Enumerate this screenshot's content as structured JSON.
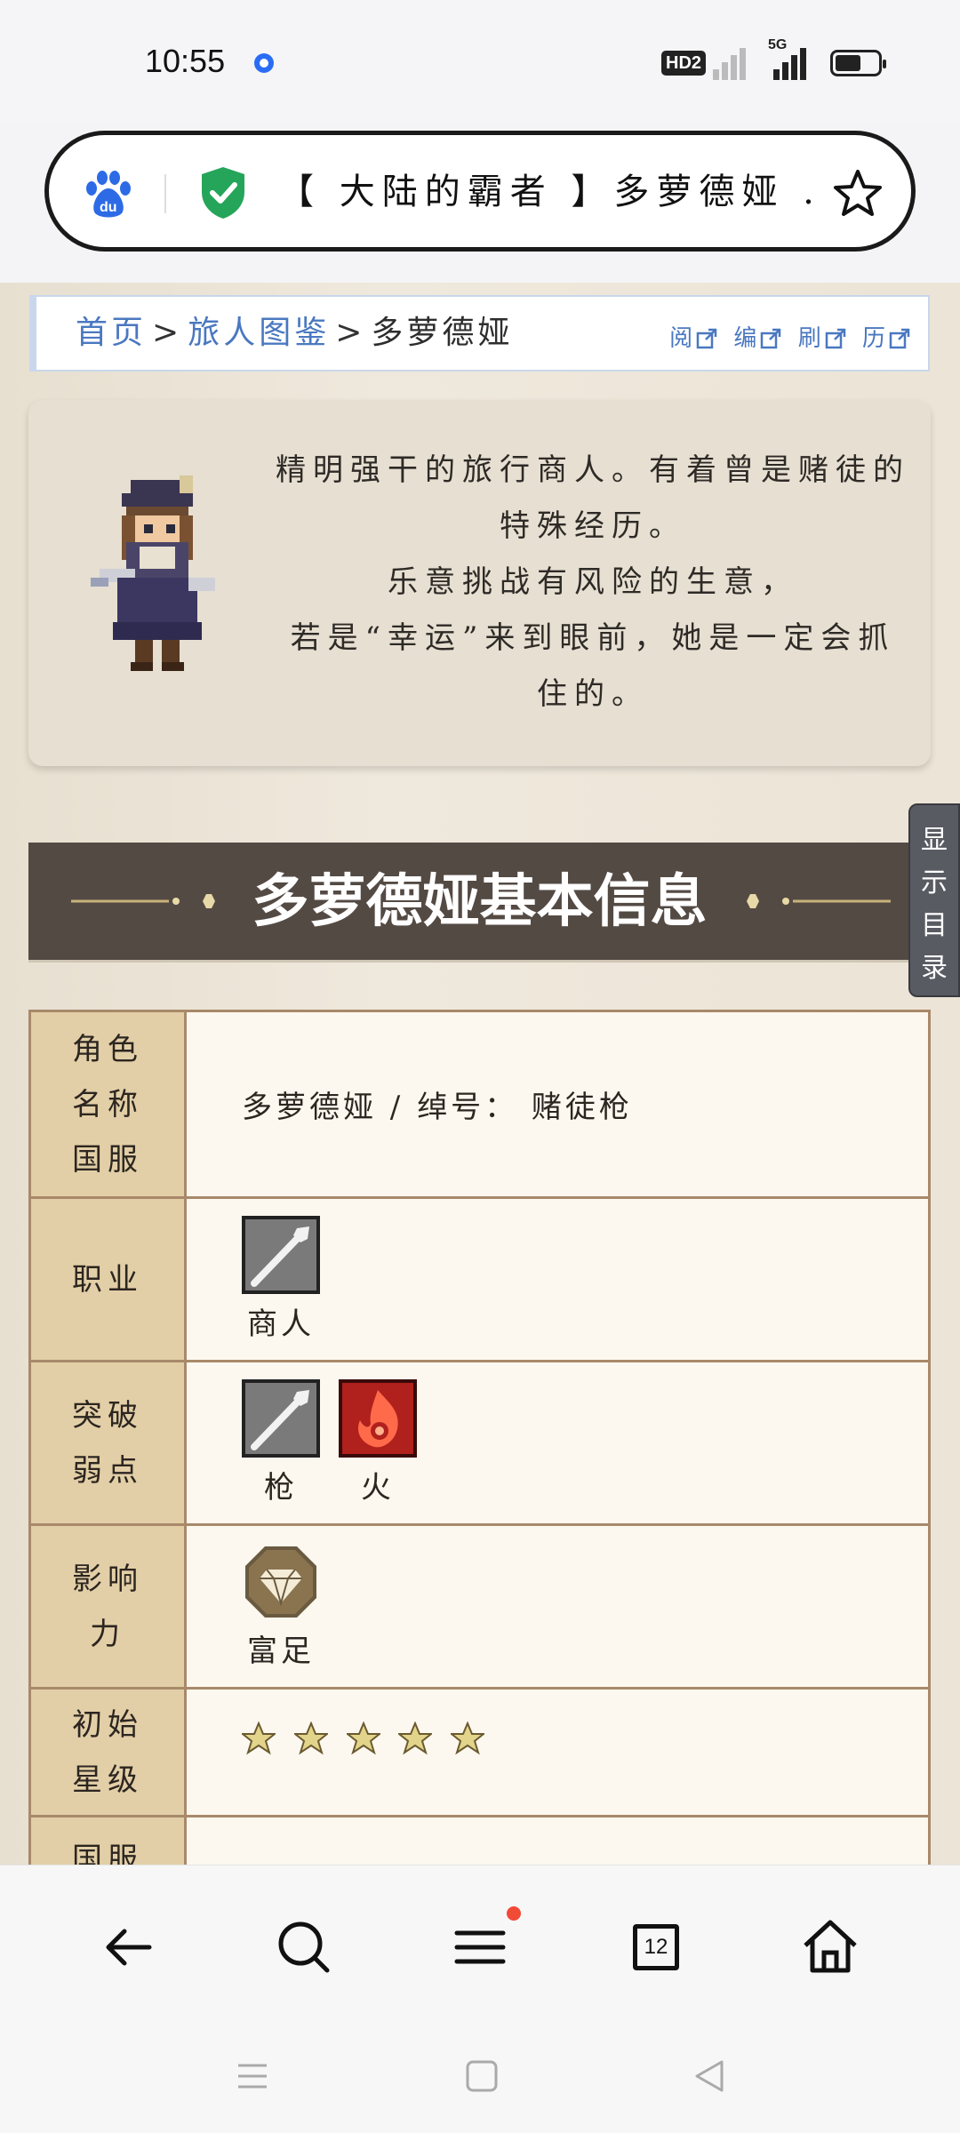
{
  "status": {
    "time": "10:55",
    "hd_label": "HD2",
    "net_label": "5G"
  },
  "urlbar": {
    "title": "【 大陆的霸者 】多萝德娅 ..."
  },
  "breadcrumb": {
    "home": "首页",
    "section": "旅人图鉴",
    "current": "多萝德娅",
    "separator": ">",
    "tools": [
      "阅",
      "编",
      "刷",
      "历"
    ]
  },
  "intro": {
    "lines": [
      "精明强干的旅行商人。有着曾是赌徒的",
      "特殊经历。",
      "乐意挑战有风险的生意，",
      "若是“幸运”来到眼前，她是一定会抓",
      "住的。"
    ]
  },
  "toc_tab": {
    "label_chars": [
      "显",
      "示",
      "目",
      "录"
    ]
  },
  "section": {
    "title": "多萝德娅基本信息"
  },
  "info_table": {
    "rows": [
      {
        "label_lines": [
          "角色",
          "名称",
          "国服"
        ],
        "value": "多萝德娅 / 绰号： 赌徒枪"
      },
      {
        "label_lines": [
          "职业"
        ],
        "icons": [
          {
            "icon": "spear-icon",
            "caption": "商人"
          }
        ]
      },
      {
        "label_lines": [
          "突破",
          "弱点"
        ],
        "icons": [
          {
            "icon": "spear-icon",
            "caption": "枪"
          },
          {
            "icon": "fire-icon",
            "caption": "火"
          }
        ]
      },
      {
        "label_lines": [
          "影响",
          "力"
        ],
        "icons": [
          {
            "icon": "gem-icon",
            "caption": "富足"
          }
        ]
      },
      {
        "label_lines": [
          "初始",
          "星级"
        ],
        "stars": 5
      },
      {
        "label_lines": [
          "国服"
        ]
      }
    ]
  },
  "bottom_nav": {
    "tab_count": "12",
    "items": [
      "back-icon",
      "search-icon",
      "menu-icon",
      "tabs-icon",
      "home-icon"
    ]
  },
  "colors": {
    "link": "#4a78c0",
    "section_bg": "#544a44",
    "label_bg": "#e3cfa7",
    "table_border": "#a8896a",
    "badge": "#f14a37"
  }
}
